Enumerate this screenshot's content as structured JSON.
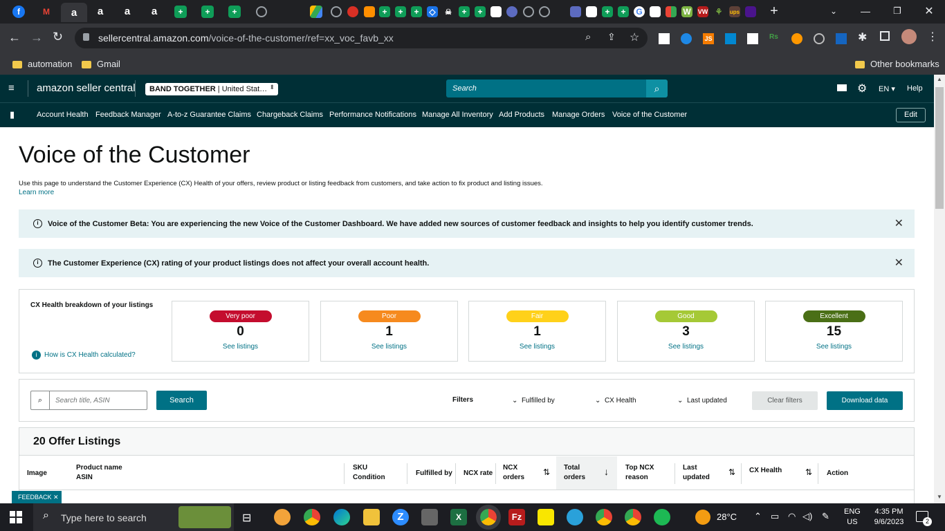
{
  "browser": {
    "url_domain": "sellercentral.amazon.com",
    "url_path": "/voice-of-the-customer/ref=xx_voc_favb_xx",
    "bookmarks": [
      "automation",
      "Gmail"
    ],
    "other_bookmarks": "Other bookmarks"
  },
  "header": {
    "logo": "amazon seller central",
    "store_name": "BAND TOGETHER",
    "store_region": "United Stat…",
    "search_placeholder": "Search",
    "language": "EN",
    "help": "Help"
  },
  "nav": {
    "items": [
      "Account Health",
      "Feedback Manager",
      "A-to-z Guarantee Claims",
      "Chargeback Claims",
      "Performance Notifications",
      "Manage All Inventory",
      "Add Products",
      "Manage Orders",
      "Voice of the Customer"
    ],
    "edit": "Edit"
  },
  "page": {
    "title": "Voice of the Customer",
    "description": "Use this page to understand the Customer Experience (CX) Health of your offers, review product or listing feedback from customers, and take action to fix product and listing issues.",
    "learn_more": "Learn more",
    "banner1": "Voice of the Customer Beta: You are experiencing the new Voice of the Customer Dashboard. We have added new sources of customer feedback and insights to help you identify customer trends.",
    "banner2": "The Customer Experience (CX) rating of your product listings does not affect your overall account health."
  },
  "cx_health": {
    "heading": "CX Health breakdown of your listings",
    "how_link": "How is CX Health calculated?",
    "cards": [
      {
        "label": "Very poor",
        "count": "0",
        "link": "See listings",
        "color": "#c40d2e",
        "text": "#ffffff"
      },
      {
        "label": "Poor",
        "count": "1",
        "link": "See listings",
        "color": "#f68a1e",
        "text": "#ffffff"
      },
      {
        "label": "Fair",
        "count": "1",
        "link": "See listings",
        "color": "#ffd11a",
        "text": "#ffffff"
      },
      {
        "label": "Good",
        "count": "3",
        "link": "See listings",
        "color": "#a5c936",
        "text": "#ffffff"
      },
      {
        "label": "Excellent",
        "count": "15",
        "link": "See listings",
        "color": "#4a6f16",
        "text": "#ffffff"
      }
    ]
  },
  "filters": {
    "search_placeholder": "Search title, ASIN",
    "search_button": "Search",
    "label": "Filters",
    "fulfilled_by": "Fulfilled by",
    "cx_health": "CX Health",
    "last_updated": "Last updated",
    "clear": "Clear filters",
    "download": "Download data"
  },
  "table": {
    "title": "20 Offer Listings",
    "col_image": "Image",
    "col_product": "Product name",
    "col_asin": "ASIN",
    "col_sku": "SKU",
    "col_condition": "Condition",
    "col_fulfilled": "Fulfilled by",
    "col_ncx_rate": "NCX rate",
    "col_ncx_orders_1": "NCX",
    "col_ncx_orders_2": "orders",
    "col_total_1": "Total",
    "col_total_2": "orders",
    "col_top_1": "Top NCX",
    "col_top_2": "reason",
    "col_last_1": "Last",
    "col_last_2": "updated",
    "col_cx": "CX Health",
    "col_action": "Action"
  },
  "feedback_tab": "FEEDBACK",
  "taskbar": {
    "search_placeholder": "Type here to search",
    "weather": "28°C",
    "lang1": "ENG",
    "lang2": "US",
    "time": "4:35 PM",
    "date": "9/6/2023",
    "notif": "2"
  }
}
